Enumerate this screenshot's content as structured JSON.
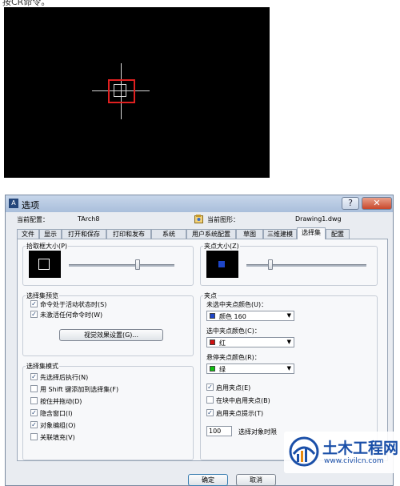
{
  "caption": "按CR命令。",
  "dialog": {
    "title": "选项",
    "help_label": "?",
    "close_label": "✕",
    "current_profile_label": "当前配置：",
    "current_profile_value": "TArch8",
    "current_drawing_label": "当前图形：",
    "current_drawing_value": "Drawing1.dwg",
    "tabs": [
      "文件",
      "显示",
      "打开和保存",
      "打印和发布",
      "系统",
      "用户系统配置",
      "草图",
      "三维建模",
      "选择集",
      "配置"
    ],
    "active_tab": "选择集",
    "pickbox": {
      "title": "拾取框大小(P)",
      "slider_level": 0.65
    },
    "grip_size": {
      "title": "夹点大小(Z)",
      "slider_level": 0.2
    },
    "preview": {
      "title": "选择集预览",
      "when_command_active": "命令处于活动状态时(S)",
      "when_command_active_checked": true,
      "when_no_command": "未激活任何命令时(W)",
      "when_no_command_checked": true,
      "visual_effects_button": "视觉效果设置(G)..."
    },
    "selection_modes": {
      "title": "选择集模式",
      "items": [
        {
          "label": "先选择后执行(N)",
          "checked": true
        },
        {
          "label": "用 Shift 键添加到选择集(F)",
          "checked": false
        },
        {
          "label": "按住并拖动(D)",
          "checked": false
        },
        {
          "label": "隐含窗口(I)",
          "checked": true
        },
        {
          "label": "对象编组(O)",
          "checked": true
        },
        {
          "label": "关联填充(V)",
          "checked": false
        }
      ]
    },
    "grips": {
      "title": "夹点",
      "unselected_label": "未选中夹点颜色(U)：",
      "unselected_value": "颜色 160",
      "unselected_color": "#1e46c8",
      "selected_label": "选中夹点颜色(C)：",
      "selected_value": "红",
      "selected_color": "#d01010",
      "hover_label": "悬停夹点颜色(R)：",
      "hover_value": "绿",
      "hover_color": "#10c010",
      "enable_grips": "启用夹点(E)",
      "enable_grips_checked": true,
      "enable_in_blocks": "在块中启用夹点(B)",
      "enable_in_blocks_checked": false,
      "enable_tips": "启用夹点提示(T)",
      "enable_tips_checked": true,
      "object_limit_value": "100",
      "object_limit_label": "选择对象时限"
    },
    "ok_button": "确定",
    "cancel_button": "取消"
  },
  "watermark": {
    "title": "土木工程网",
    "url": "www.civilcn.com"
  },
  "colors": {
    "pickbox_red": "#e02020",
    "grip_blue": "#1e46c8",
    "watermark_blue": "#1a4fa8"
  }
}
